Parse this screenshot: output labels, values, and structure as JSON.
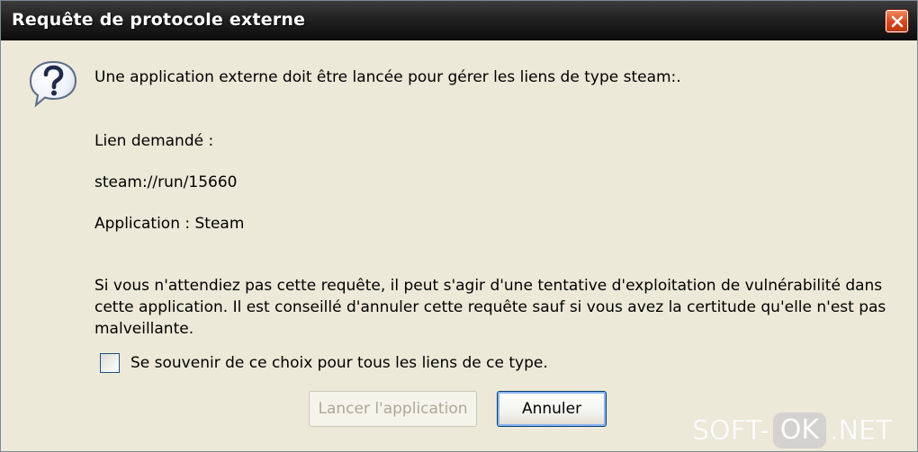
{
  "window": {
    "title": "Requête de protocole externe",
    "close_icon": "close-icon"
  },
  "dialog": {
    "icon": "question-bubble-icon",
    "message": "Une application externe doit être lancée pour gérer les liens de type steam:.",
    "link_label": "Lien demandé :",
    "link_value": "steam://run/15660",
    "application_line": "Application : Steam",
    "warning": "Si vous n'attendiez pas cette requête, il peut s'agir d'une tentative d'exploitation de vulnérabilité dans cette application. Il est conseillé d'annuler cette requête sauf si vous avez la certitude qu'elle n'est pas malveillante.",
    "remember_choice": {
      "label": "Se souvenir de ce choix pour tous les liens de ce type.",
      "checked": false
    },
    "buttons": {
      "launch_label": "Lancer l'application",
      "launch_enabled": false,
      "cancel_label": "Annuler"
    }
  },
  "watermark": {
    "prefix": "SOFT-",
    "badge": "OK",
    "suffix": ".NET"
  },
  "colors": {
    "titlebar": "#1a1a1a",
    "dialog_bg": "#ece9d8",
    "close_button": "#d9461c",
    "focus_border": "#003c74"
  }
}
